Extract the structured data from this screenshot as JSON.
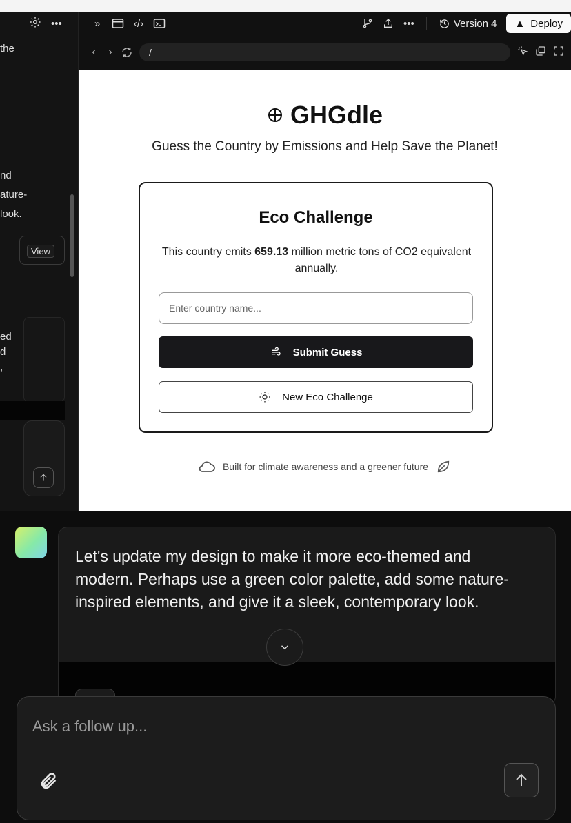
{
  "sidebar": {
    "header_icons": [
      "gear-icon",
      "more-horizontal-icon"
    ],
    "text_lines": [
      "the",
      "nd",
      "ature-",
      "look.",
      "ed",
      "d",
      ","
    ],
    "view_label": "View"
  },
  "toolbar": {
    "icons": [
      "expand-icon",
      "preview-window-icon",
      "code-icon",
      "terminal-icon",
      "git-branch-icon",
      "share-icon",
      "more-icon"
    ],
    "version_label": "Version 4",
    "deploy_label": "Deploy"
  },
  "addressbar": {
    "url": "/"
  },
  "preview": {
    "title": "GHGdle",
    "subtitle": "Guess the Country by Emissions and Help Save the Planet!",
    "card": {
      "title": "Eco Challenge",
      "desc_prefix": "This country emits ",
      "emissions_value": "659.13",
      "desc_suffix": " million metric tons of CO2 equivalent annually.",
      "input_placeholder": "Enter country name...",
      "submit_label": "Submit Guess",
      "new_label": "New Eco Challenge"
    },
    "footer_text": "Built for climate awareness and a greener future"
  },
  "chat": {
    "message": "Let's update my design to make it more eco-themed and modern. Perhaps use a green color palette, add some nature-inspired elements, and give it a sleek, contemporary look.",
    "composer_placeholder": "Ask a follow up..."
  }
}
